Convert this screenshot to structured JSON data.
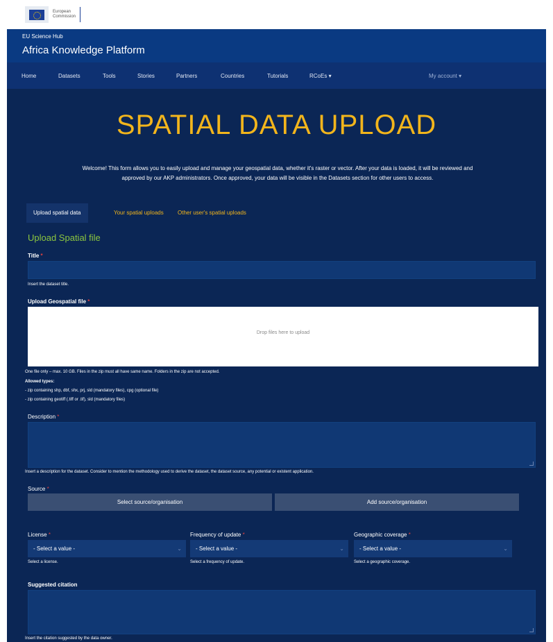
{
  "brand": {
    "line1": "European",
    "line2": "Commission"
  },
  "header": {
    "hub": "EU Science Hub",
    "platform": "Africa Knowledge Platform"
  },
  "nav": {
    "items": [
      "Home",
      "Datasets",
      "Tools",
      "Stories",
      "Partners",
      "Countries",
      "Tutorials",
      "RCoEs ▾"
    ],
    "account": "My account ▾"
  },
  "page": {
    "title": "SPATIAL DATA UPLOAD",
    "intro_line1": "Welcome! This form allows you to easily upload and manage your geospatial data, whether it's raster or vector. After your data is loaded, it will be reviewed and",
    "intro_line2": "approved by our AKP administrators. Once approved, your data will be visible in the Datasets section for other users to access."
  },
  "tabs": [
    "Upload spatial data",
    "Your spatial uploads",
    "Other user's spatial uploads"
  ],
  "form": {
    "section_title": "Upload Spatial file",
    "title_label": "Title",
    "title_help": "Insert the dataset title.",
    "upload_label": "Upload Geospatial file",
    "dropzone_text": "Drop files here to upload",
    "upload_help_1": "One file only – max. 10 GB. Files in the zip must all have same name. Folders in the zip are not accepted.",
    "upload_help_2": "Allowed types:",
    "upload_help_3": "- zip containing shp, dbf, shx, prj, sld (mandatory files), cpg (optional file)",
    "upload_help_4": "- zip containing geotiff (.tiff or .tif), sld (mandatory files)",
    "description_label": "Description",
    "description_help": "Insert a description for the dataset. Consider to mention the methodology used to derive the dataset, the dataset source, any potential or existent application.",
    "source_label": "Source",
    "select_source_button": "Select source/organisation",
    "add_source_button": "Add source/organisation",
    "license_label": "License",
    "license_value": "- Select a value -",
    "license_help": "Select a license.",
    "frequency_label": "Frequency of update",
    "frequency_value": "- Select a value -",
    "frequency_help": "Select a frequency of update.",
    "coverage_label": "Geographic coverage",
    "coverage_value": "- Select a value -",
    "coverage_help": "Select a geographic coverage.",
    "citation_label": "Suggested citation",
    "citation_help": "Insert the citation suggested by the data owner.",
    "required_mark": "*"
  },
  "colors": {
    "header": "#0a3a82",
    "nav": "#0e3172",
    "main_bg": "#0b2655",
    "title": "#f2b51c",
    "section_title": "#8cc63f",
    "required": "#e04040"
  }
}
